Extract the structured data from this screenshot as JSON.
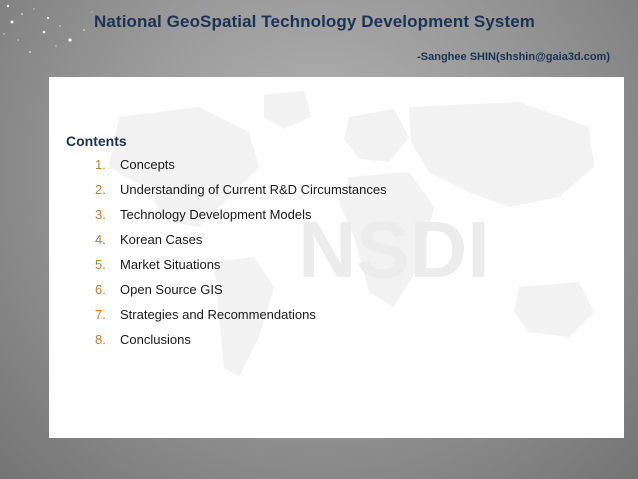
{
  "slide": {
    "title": "National GeoSpatial Technology Development System",
    "author": "-Sanghee SHIN(shshin@gaia3d.com)"
  },
  "watermark": {
    "text": "NSDI"
  },
  "contents": {
    "heading": "Contents",
    "items": [
      {
        "number": "1.",
        "label": "Concepts"
      },
      {
        "number": "2.",
        "label": "Understanding of Current R&D Circumstances"
      },
      {
        "number": "3.",
        "label": "Technology Development Models"
      },
      {
        "number": "4.",
        "label": "Korean Cases"
      },
      {
        "number": "5.",
        "label": "Market Situations"
      },
      {
        "number": "6.",
        "label": "Open Source GIS"
      },
      {
        "number": "7.",
        "label": "Strategies and Recommendations"
      },
      {
        "number": "8.",
        "label": "Conclusions"
      }
    ]
  },
  "colors": {
    "title": "#1b3352",
    "list_number": "#cc7b28",
    "panel": "#ffffff",
    "background": "#9a9a9a"
  }
}
